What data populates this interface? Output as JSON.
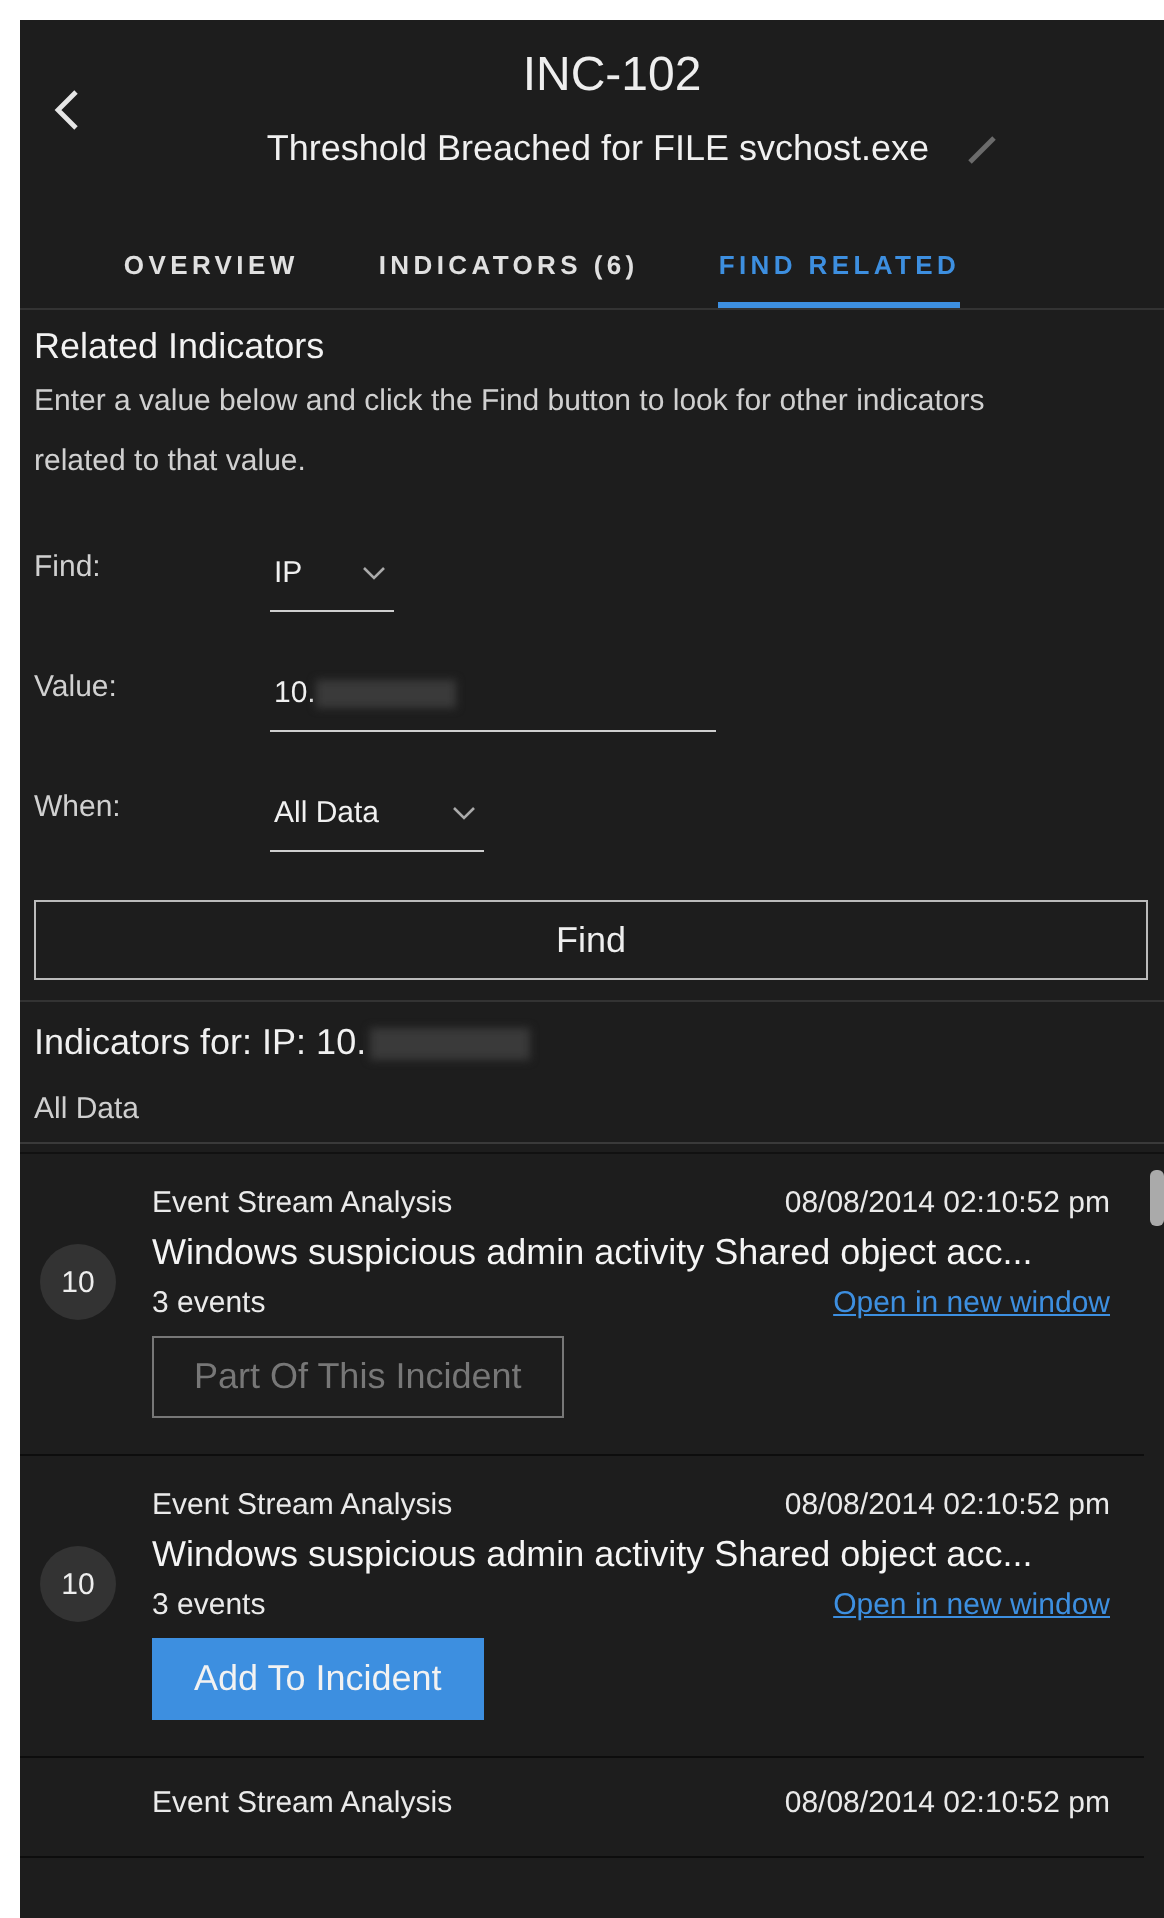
{
  "header": {
    "incident_id": "INC-102",
    "title": "Threshold Breached for FILE svchost.exe"
  },
  "tabs": [
    {
      "label": "OVERVIEW",
      "selected": false
    },
    {
      "label": "INDICATORS (6)",
      "selected": false
    },
    {
      "label": "FIND RELATED",
      "selected": true
    }
  ],
  "related": {
    "heading": "Related Indicators",
    "description": "Enter a value below and click the Find button to look for other indicators related to that value.",
    "find": {
      "label": "Find:",
      "value": "IP"
    },
    "value": {
      "label": "Value:",
      "value": "10."
    },
    "when": {
      "label": "When:",
      "value": "All Data"
    },
    "button": "Find"
  },
  "results": {
    "heading": "Indicators for: IP: 10.",
    "range": "All Data"
  },
  "cards": [
    {
      "source": "Event Stream Analysis",
      "time": "08/08/2014 02:10:52 pm",
      "title": "Windows suspicious admin activity Shared object acc...",
      "score": "10",
      "events": "3 events",
      "link": "Open in new window",
      "kind": "part",
      "action": "Part Of This Incident"
    },
    {
      "source": "Event Stream Analysis",
      "time": "08/08/2014 02:10:52 pm",
      "title": "Windows suspicious admin activity Shared object acc...",
      "score": "10",
      "events": "3 events",
      "link": "Open in new window",
      "kind": "add",
      "action": "Add To Incident"
    },
    {
      "source": "Event Stream Analysis",
      "time": "08/08/2014 02:10:52 pm",
      "kind": "partial"
    }
  ]
}
